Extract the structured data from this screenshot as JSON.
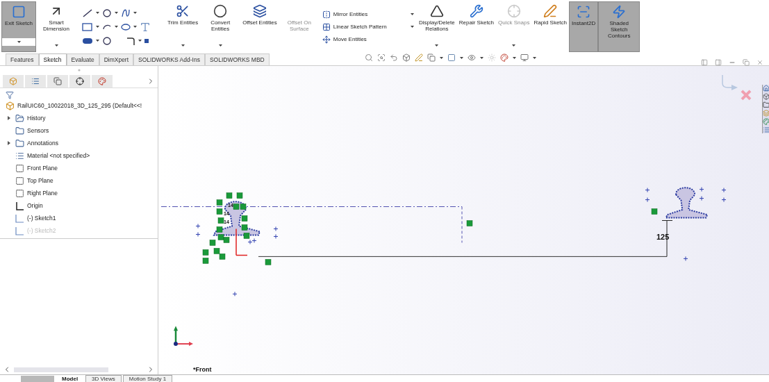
{
  "ribbon": [
    {
      "kind": "large",
      "label": "Exit Sketch",
      "selected": true,
      "disabled": false,
      "dropdown": true
    },
    {
      "kind": "large",
      "label": "Smart Dimension",
      "selected": false,
      "disabled": false,
      "dropdown": true
    },
    {
      "kind": "tools"
    },
    {
      "kind": "large",
      "label": "Trim Entities",
      "selected": false,
      "disabled": false,
      "dropdown": true
    },
    {
      "kind": "large",
      "label": "Convert Entities",
      "selected": false,
      "disabled": false,
      "dropdown": true
    },
    {
      "kind": "large",
      "label": "Offset Entities",
      "selected": false,
      "disabled": false,
      "dropdown": false
    },
    {
      "kind": "large",
      "label": "Offset On Surface",
      "selected": false,
      "disabled": true,
      "dropdown": false
    },
    {
      "kind": "stack",
      "items": [
        {
          "label": "Mirror Entities"
        },
        {
          "label": "Linear Sketch Pattern"
        },
        {
          "label": "Move Entities"
        }
      ]
    },
    {
      "kind": "large",
      "label": "Display/Delete Relations",
      "selected": false,
      "disabled": false,
      "dropdown": true
    },
    {
      "kind": "large",
      "label": "Repair Sketch",
      "selected": false,
      "disabled": false,
      "dropdown": false
    },
    {
      "kind": "large",
      "label": "Quick Snaps",
      "selected": false,
      "disabled": true,
      "dropdown": true
    },
    {
      "kind": "large",
      "label": "Rapid Sketch",
      "selected": false,
      "disabled": false,
      "dropdown": false
    },
    {
      "kind": "large",
      "label": "Instant2D",
      "selected": true,
      "disabled": false,
      "dropdown": false
    },
    {
      "kind": "large",
      "label": "Shaded Sketch Contours",
      "selected": true,
      "disabled": false,
      "dropdown": false
    }
  ],
  "tabs": [
    {
      "label": "Features",
      "selected": false
    },
    {
      "label": "Sketch",
      "selected": true
    },
    {
      "label": "Evaluate",
      "selected": false
    },
    {
      "label": "DimXpert",
      "selected": false
    },
    {
      "label": "SOLIDWORKS Add-Ins",
      "selected": false
    },
    {
      "label": "SOLIDWORKS MBD",
      "selected": false
    }
  ],
  "tree": {
    "root": "RailUIC60_10022018_3D_125_295  (Default<<!",
    "items": [
      {
        "label": "History",
        "expandable": true,
        "dimmed": false
      },
      {
        "label": "Sensors",
        "expandable": false,
        "dimmed": false
      },
      {
        "label": "Annotations",
        "expandable": true,
        "dimmed": false
      },
      {
        "label": "Material <not specified>",
        "expandable": false,
        "dimmed": false
      },
      {
        "label": "Front Plane",
        "expandable": false,
        "dimmed": false
      },
      {
        "label": "Top Plane",
        "expandable": false,
        "dimmed": false
      },
      {
        "label": "Right Plane",
        "expandable": false,
        "dimmed": false
      },
      {
        "label": "Origin",
        "expandable": false,
        "dimmed": false
      },
      {
        "label": "(-) Sketch1",
        "expandable": false,
        "dimmed": false
      },
      {
        "label": "(-) Sketch2",
        "expandable": false,
        "dimmed": true
      }
    ]
  },
  "canvas": {
    "dimension": "125",
    "small_dimensions": [
      "14",
      "14",
      "14"
    ],
    "view_name": "*Front"
  },
  "bottom_tabs": [
    {
      "label": "Model",
      "selected": true
    },
    {
      "label": "3D Views",
      "selected": false
    },
    {
      "label": "Motion Study 1",
      "selected": false
    }
  ]
}
